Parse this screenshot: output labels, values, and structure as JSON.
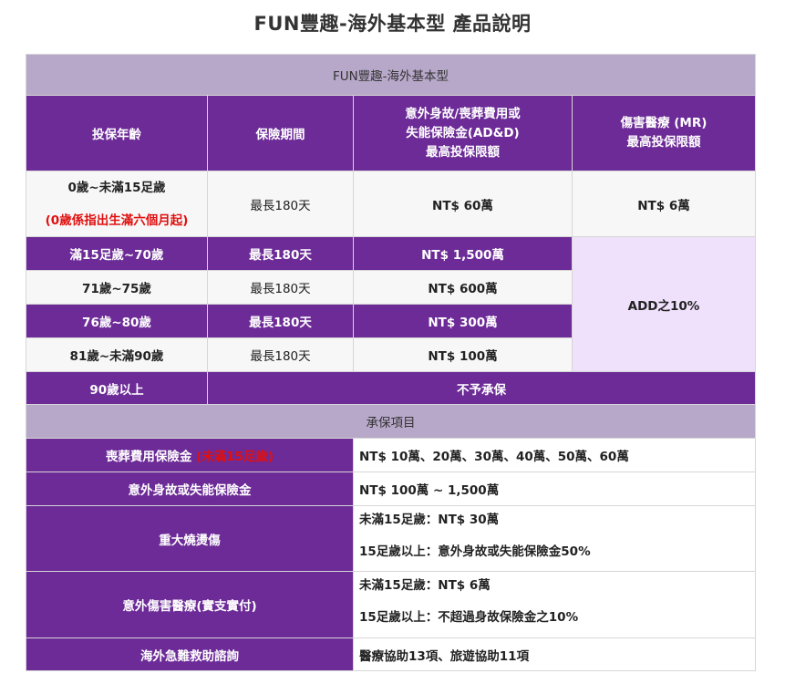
{
  "page_title": "FUN豐趣-海外基本型 產品說明",
  "table": {
    "plan_name": "FUN豐趣-海外基本型",
    "headers": {
      "age": "投保年齡",
      "period": "保險期間",
      "add_line1": "意外身故/喪葬費用或",
      "add_line2": "失能保險金(AD&D)",
      "add_line3": "最高投保限額",
      "mr_line1": "傷害醫療 (MR)",
      "mr_line2": "最高投保限額"
    },
    "rows": [
      {
        "age": "0歲~未滿15足歲",
        "age_note": "(0歲係指出生滿六個月起)",
        "period": "最長180天",
        "add": "NT$ 60萬",
        "mr": "NT$ 6萬"
      },
      {
        "age": "滿15足歲~70歲",
        "period": "最長180天",
        "add": "NT$ 1,500萬"
      },
      {
        "age": "71歲~75歲",
        "period": "最長180天",
        "add": "NT$ 600萬"
      },
      {
        "age": "76歲~80歲",
        "period": "最長180天",
        "add": "NT$ 300萬"
      },
      {
        "age": "81歲~未滿90歲",
        "period": "最長180天",
        "add": "NT$ 100萬"
      }
    ],
    "mr_merged": "ADD之10%",
    "row_90": {
      "age": "90歲以上",
      "value": "不予承保"
    },
    "coverage_title": "承保項目",
    "coverage": [
      {
        "label": "喪葬費用保險金",
        "label_note": "(未滿15足歲)",
        "lines": [
          "NT$ 10萬、20萬、30萬、40萬、50萬、60萬"
        ]
      },
      {
        "label": "意外身故或失能保險金",
        "lines": [
          "NT$ 100萬 ~ 1,500萬"
        ]
      },
      {
        "label": "重大燒燙傷",
        "lines": [
          "未滿15足歲：NT$ 30萬",
          "15足歲以上：意外身故或失能保險金50%"
        ]
      },
      {
        "label": "意外傷害醫療(實支實付)",
        "lines": [
          "未滿15足歲：NT$ 6萬",
          "15足歲以上：不超過身故保險金之10%"
        ]
      },
      {
        "label": "海外急難救助諮詢",
        "lines": [
          "醫療協助13項、旅遊協助11項"
        ]
      }
    ]
  },
  "colors": {
    "purple": "#6c2b97",
    "header_gray": "#b7a8c9",
    "lavender": "#efe0fb",
    "red": "#e01010"
  }
}
